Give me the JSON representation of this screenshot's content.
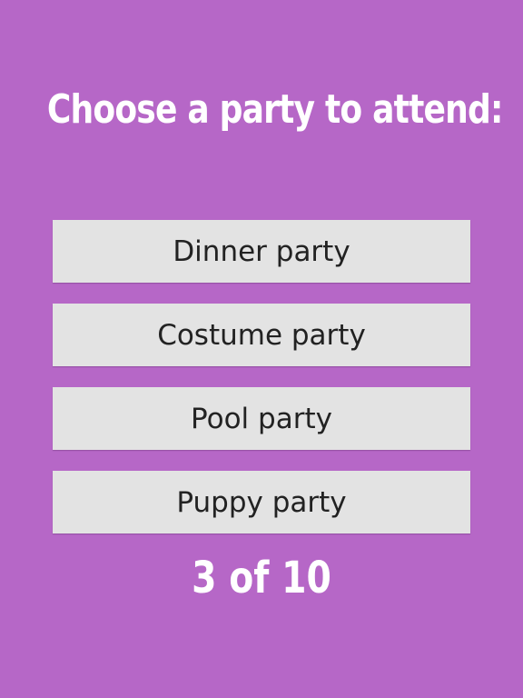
{
  "title": "Choose a party to attend:",
  "choices": [
    {
      "label": "Dinner party"
    },
    {
      "label": "Costume party"
    },
    {
      "label": "Pool party"
    },
    {
      "label": "Puppy party"
    }
  ],
  "progress": {
    "current": 3,
    "total": 10,
    "label": "3 of 10"
  },
  "colors": {
    "background": "#b667c7",
    "button": "#e3e3e3",
    "button_text": "#222222",
    "heading_text": "#ffffff"
  }
}
